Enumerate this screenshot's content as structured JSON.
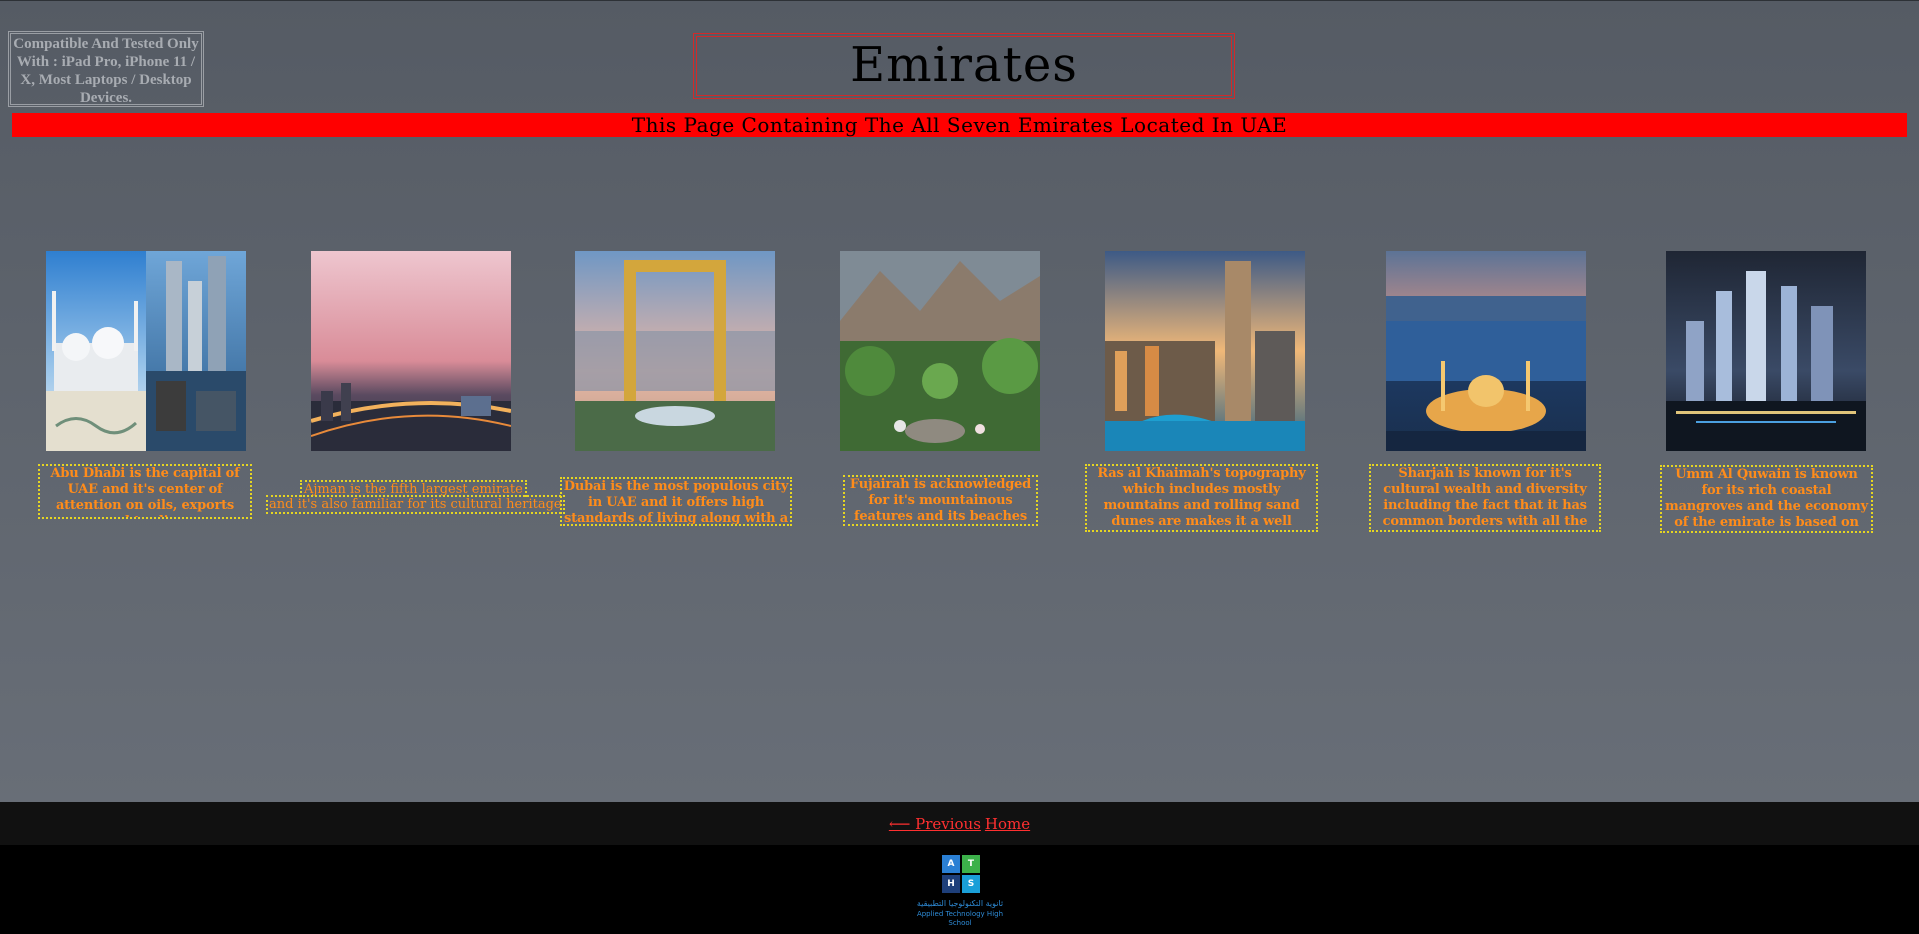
{
  "notice": {
    "compatibility": "Compatible And Tested Only With : iPad Pro, iPhone 11 / X, Most Laptops / Desktop Devices."
  },
  "header": {
    "title": "Emirates",
    "subtitle": "This Page Containing The All Seven Emirates Located In UAE"
  },
  "emirates": [
    {
      "name": "abu-dhabi",
      "caption": "Abu Dhabi is the capital of UAE and it's center of attention on oils, exports and trading"
    },
    {
      "name": "ajman",
      "caption_line1": "Ajman is the fifth largest emirate",
      "caption_line2": "and it's also familiar for its cultural heritage"
    },
    {
      "name": "dubai",
      "caption": "Dubai is the most populous city in UAE and it offers high standards of living along with a luxurious life"
    },
    {
      "name": "fujairah",
      "caption": "Fujairah is acknowledged for it's mountainous features and its beaches"
    },
    {
      "name": "ras-al-khaimah",
      "caption": "Ras al Khaimah's topography which includes mostly mountains and rolling sand dunes are makes it a well known emirate"
    },
    {
      "name": "sharjah",
      "caption": "Sharjah is known for it's cultural wealth and diversity including the fact that it has common borders with all the other emirates"
    },
    {
      "name": "umm-al-quwain",
      "caption": "Umm Al Quwain is known for its rich coastal mangroves and the economy of the emirate is based on pearls, diving, agriculture,etc"
    }
  ],
  "footer": {
    "previous_link": "⟵ Previous",
    "home_link": "Home",
    "logo": {
      "letters": [
        "A",
        "T",
        "H",
        "S"
      ],
      "arabic": "ثانوية التكنولوجيا التطبيقية",
      "english": "Applied Technology High School"
    }
  },
  "colors": {
    "banner": "#ff0000",
    "title_border": "#d12a2a",
    "caption_text": "#ff8c1a",
    "caption_border": "#e6d521",
    "link": "#ff3030"
  }
}
